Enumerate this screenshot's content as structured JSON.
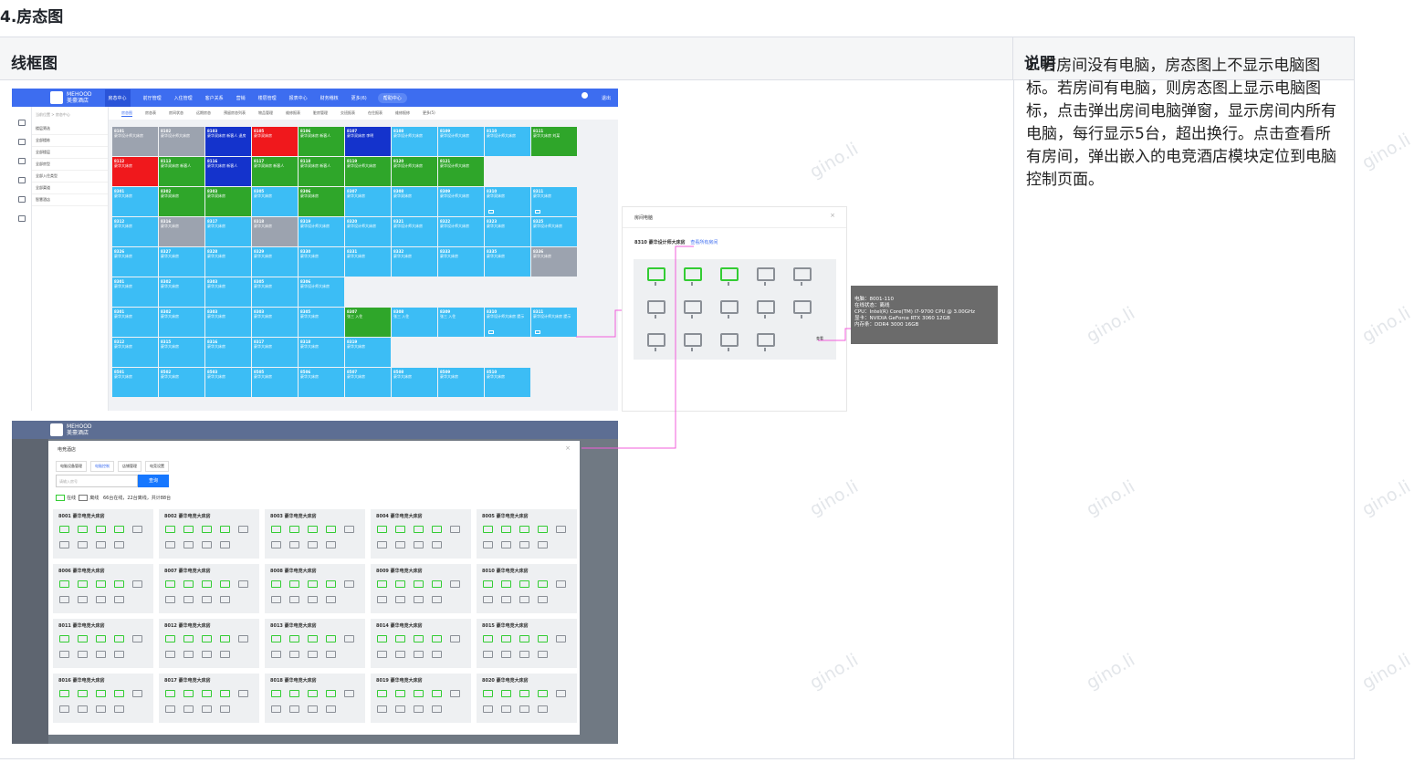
{
  "doc": {
    "section_title": "4.房态图",
    "table": {
      "header_wireframe": "线框图",
      "header_description": "说明",
      "description": "1.若房间没有电脑，房态图上不显示电脑图标。若房间有电脑，则房态图上显示电脑图标，点击弹出房间电脑弹窗，显示房间内所有电脑，每行显示5台，超出换行。点击查看所有房间，弹出嵌入的电竞酒店模块定位到电脑控制页面。"
    }
  },
  "watermark": "gino.li",
  "app": {
    "brand_en": "MEHOOD",
    "brand_cn": "美豪酒店",
    "nav": [
      "房态中心",
      "前厅管理",
      "入住管理",
      "客户关系",
      "营销",
      "楼层管理",
      "报表中心",
      "财务稽核",
      "更多(6)"
    ],
    "top_button": "帮助中心",
    "logout": "退出"
  },
  "room_status": {
    "sub_tabs": [
      "房态图",
      "房态表",
      "房间状态",
      "远期房态",
      "预留房态列表",
      "物品管理",
      "维修报表",
      "脏房管理",
      "交班报表",
      "在住报表",
      "维修报修",
      "更多(5)"
    ],
    "filter_crumb": "当前位置 > 房态中心",
    "filter_items": [
      "楼层筛选",
      "全部楼栋",
      "全部楼层",
      "全部房型",
      "全部入住类型",
      "全部渠道",
      "智慧酒店"
    ],
    "rooms": [
      {
        "num": "8101",
        "text": "豪华设计师大床房",
        "status": "gray"
      },
      {
        "num": "8102",
        "text": "豪华设计师大床房",
        "status": "gray"
      },
      {
        "num": "8103",
        "text": "豪华双床房 新客人 退房",
        "status": "navy"
      },
      {
        "num": "8105",
        "text": "豪华双床房",
        "status": "red"
      },
      {
        "num": "8106",
        "text": "豪华双床房 新客人",
        "status": "green"
      },
      {
        "num": "8107",
        "text": "豪华双床房 李明",
        "status": "navy"
      },
      {
        "num": "8108",
        "text": "豪华设计师大床房",
        "status": "blue"
      },
      {
        "num": "8109",
        "text": "豪华设计师大床房",
        "status": "blue"
      },
      {
        "num": "8110",
        "text": "豪华设计师大床房",
        "status": "blue"
      },
      {
        "num": "8111",
        "text": "豪华大床房 刘某",
        "status": "green"
      },
      {
        "num": "8112",
        "text": "豪华大床房",
        "status": "red"
      },
      {
        "num": "8113",
        "text": "豪华双床房 新客人",
        "status": "green"
      },
      {
        "num": "8116",
        "text": "豪华大床房 新客人",
        "status": "navy"
      },
      {
        "num": "8117",
        "text": "豪华双床房 新客人",
        "status": "green"
      },
      {
        "num": "8118",
        "text": "豪华双床房 新客人",
        "status": "green"
      },
      {
        "num": "8119",
        "text": "豪华设计师大床房",
        "status": "green"
      },
      {
        "num": "8120",
        "text": "豪华设计师大床房",
        "status": "green"
      },
      {
        "num": "8121",
        "text": "豪华设计师大床房",
        "status": "green"
      },
      {
        "num": "",
        "text": "",
        "status": "empty"
      },
      {
        "num": "",
        "text": "",
        "status": "empty"
      },
      {
        "num": "8301",
        "text": "豪华大床房",
        "status": "blue"
      },
      {
        "num": "8302",
        "text": "豪华双床房",
        "status": "green"
      },
      {
        "num": "8303",
        "text": "豪华双床房",
        "status": "green"
      },
      {
        "num": "8305",
        "text": "豪华大床房",
        "status": "blue"
      },
      {
        "num": "8306",
        "text": "豪华双床房",
        "status": "green"
      },
      {
        "num": "8307",
        "text": "豪华大床房",
        "status": "blue"
      },
      {
        "num": "8308",
        "text": "豪华双床房",
        "status": "blue"
      },
      {
        "num": "8309",
        "text": "豪华设计师大床房",
        "status": "blue"
      },
      {
        "num": "8310",
        "text": "豪华双床房",
        "status": "blue"
      },
      {
        "num": "8311",
        "text": "豪华大床房",
        "status": "blue"
      },
      {
        "num": "8312",
        "text": "豪华大床房",
        "status": "blue"
      },
      {
        "num": "8316",
        "text": "豪华大床房",
        "status": "gray"
      },
      {
        "num": "8317",
        "text": "豪华大床房",
        "status": "blue"
      },
      {
        "num": "8318",
        "text": "豪华大床房",
        "status": "gray"
      },
      {
        "num": "8319",
        "text": "豪华设计师大床房",
        "status": "blue"
      },
      {
        "num": "8320",
        "text": "豪华设计师大床房",
        "status": "blue"
      },
      {
        "num": "8321",
        "text": "豪华设计师大床房",
        "status": "blue"
      },
      {
        "num": "8322",
        "text": "豪华设计师大床房",
        "status": "blue"
      },
      {
        "num": "8323",
        "text": "豪华大床房",
        "status": "blue"
      },
      {
        "num": "8325",
        "text": "豪华设计师大床房",
        "status": "blue"
      },
      {
        "num": "8326",
        "text": "豪华大床房",
        "status": "blue"
      },
      {
        "num": "8327",
        "text": "豪华大床房",
        "status": "blue"
      },
      {
        "num": "8328",
        "text": "豪华大床房",
        "status": "blue"
      },
      {
        "num": "8329",
        "text": "豪华大床房",
        "status": "blue"
      },
      {
        "num": "8330",
        "text": "豪华大床房",
        "status": "blue"
      },
      {
        "num": "8331",
        "text": "豪华大床房",
        "status": "blue"
      },
      {
        "num": "8332",
        "text": "豪华大床房",
        "status": "blue"
      },
      {
        "num": "8333",
        "text": "豪华大床房",
        "status": "blue"
      },
      {
        "num": "8335",
        "text": "豪华大床房",
        "status": "blue"
      },
      {
        "num": "8336",
        "text": "豪华大床房",
        "status": "gray"
      },
      {
        "num": "8301",
        "text": "豪华大床房",
        "status": "blue"
      },
      {
        "num": "8302",
        "text": "豪华大床房",
        "status": "blue"
      },
      {
        "num": "8303",
        "text": "豪华大床房",
        "status": "blue"
      },
      {
        "num": "8305",
        "text": "豪华大床房",
        "status": "blue"
      },
      {
        "num": "8306",
        "text": "豪华设计师大床房",
        "status": "blue"
      },
      {
        "num": "",
        "text": "",
        "status": "empty"
      },
      {
        "num": "",
        "text": "",
        "status": "empty"
      },
      {
        "num": "",
        "text": "",
        "status": "empty"
      },
      {
        "num": "",
        "text": "",
        "status": "empty"
      },
      {
        "num": "",
        "text": "",
        "status": "empty"
      },
      {
        "num": "8301",
        "text": "豪华大床房",
        "status": "blue"
      },
      {
        "num": "8302",
        "text": "豪华大床房",
        "status": "blue"
      },
      {
        "num": "8303",
        "text": "豪华大床房",
        "status": "blue"
      },
      {
        "num": "8303",
        "text": "豪华大床房",
        "status": "blue"
      },
      {
        "num": "8305",
        "text": "豪华大床房",
        "status": "blue"
      },
      {
        "num": "8307",
        "text": "张三 入住",
        "status": "green"
      },
      {
        "num": "8308",
        "text": "张三 入住",
        "status": "blue"
      },
      {
        "num": "8309",
        "text": "张三 入住",
        "status": "blue"
      },
      {
        "num": "8310",
        "text": "豪华设计师大床房 提示",
        "status": "blue"
      },
      {
        "num": "8311",
        "text": "豪华设计师大床房 提示",
        "status": "blue"
      },
      {
        "num": "8312",
        "text": "豪华大床房",
        "status": "blue"
      },
      {
        "num": "8315",
        "text": "豪华大床房",
        "status": "blue"
      },
      {
        "num": "8316",
        "text": "豪华大床房",
        "status": "blue"
      },
      {
        "num": "8317",
        "text": "豪华大床房",
        "status": "blue"
      },
      {
        "num": "8318",
        "text": "豪华大床房",
        "status": "blue"
      },
      {
        "num": "8319",
        "text": "豪华大床房",
        "status": "blue"
      },
      {
        "num": "",
        "text": "",
        "status": "empty"
      },
      {
        "num": "",
        "text": "",
        "status": "empty"
      },
      {
        "num": "",
        "text": "",
        "status": "empty"
      },
      {
        "num": "",
        "text": "",
        "status": "empty"
      },
      {
        "num": "8501",
        "text": "豪华大床房",
        "status": "blue"
      },
      {
        "num": "8502",
        "text": "豪华大床房",
        "status": "blue"
      },
      {
        "num": "8503",
        "text": "豪华大床房",
        "status": "blue"
      },
      {
        "num": "8505",
        "text": "豪华大床房",
        "status": "blue"
      },
      {
        "num": "8506",
        "text": "豪华大床房",
        "status": "blue"
      },
      {
        "num": "8507",
        "text": "豪华大床房",
        "status": "blue"
      },
      {
        "num": "8508",
        "text": "豪华大床房",
        "status": "blue"
      },
      {
        "num": "8509",
        "text": "豪华大床房",
        "status": "blue"
      },
      {
        "num": "8510",
        "text": "豪华大床房",
        "status": "blue"
      }
    ]
  },
  "room_pc_popup": {
    "title": "房间电脑",
    "close": "×",
    "room_line": "8310 豪华设计师大床房",
    "view_all_link": "查看所有房间",
    "pc_online": [
      true,
      true,
      true,
      false,
      false,
      false,
      false,
      false,
      false,
      false,
      false,
      false,
      false,
      false
    ],
    "hover_label": "查看"
  },
  "pc_tooltip": {
    "lines": [
      "电脑：8001-110",
      "在线状态：离线",
      "CPU：Intel(R) Core(TM) i7-9700 CPU @ 3.00GHz",
      "显卡：NVIDIA GeForce RTX 3060 12GB",
      "内存条：DDR4 3000 16GB"
    ]
  },
  "esports_modal": {
    "title": "电竞酒店",
    "close": "×",
    "tabs": [
      "电脑设备管理",
      "电脑控制",
      "店铺管理",
      "电竞设置"
    ],
    "active_tab": 1,
    "search_placeholder": "请输入房号",
    "search_button": "查询",
    "legend_online": "在线",
    "legend_offline": "离线",
    "stats": "66台在线，22台离线，共计88台",
    "rooms": [
      {
        "title": "8001 豪华电竞大床房"
      },
      {
        "title": "8002 豪华电竞大床房"
      },
      {
        "title": "8003 豪华电竞大床房"
      },
      {
        "title": "8004 豪华电竞大床房"
      },
      {
        "title": "8005 豪华电竞大床房"
      },
      {
        "title": "8006 豪华电竞大床房"
      },
      {
        "title": "8007 豪华电竞大床房"
      },
      {
        "title": "8008 豪华电竞大床房"
      },
      {
        "title": "8009 豪华电竞大床房"
      },
      {
        "title": "8010 豪华电竞大床房"
      },
      {
        "title": "8011 豪华电竞大床房"
      },
      {
        "title": "8012 豪华电竞大床房"
      },
      {
        "title": "8013 豪华电竞大床房"
      },
      {
        "title": "8014 豪华电竞大床房"
      },
      {
        "title": "8015 豪华电竞大床房"
      },
      {
        "title": "8016 豪华电竞大床房"
      },
      {
        "title": "8017 豪华电竞大床房"
      },
      {
        "title": "8018 豪华电竞大床房"
      },
      {
        "title": "8019 豪华电竞大床房"
      },
      {
        "title": "8020 豪华电竞大床房"
      }
    ]
  },
  "colors": {
    "primary": "#3d6df0",
    "room_blue": "#3cbdf5",
    "room_red": "#f0181c",
    "room_green": "#2fa62a",
    "room_gray": "#9ca3af",
    "room_navy": "#1433cc",
    "pc_online": "#33cc33",
    "pc_offline": "#8a8f96",
    "connector": "#f25ddb"
  }
}
